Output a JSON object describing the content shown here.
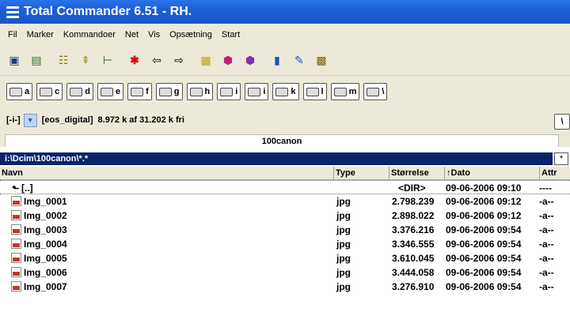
{
  "window": {
    "title": "Total Commander 6.51 - RH."
  },
  "menu": [
    "Fil",
    "Marker",
    "Kommandoer",
    "Net",
    "Vis",
    "Opsætning",
    "Start"
  ],
  "toolbar": {
    "icons": [
      "refresh-icon",
      "view-brief-icon",
      "view-full-icon",
      "tree-icon",
      "inverse-icon",
      "select-icon",
      "back-icon",
      "forward-icon",
      "pack-icon",
      "ftp-icon",
      "ftp-new-icon",
      "notepad-icon",
      "edit-icon",
      "explorer-icon"
    ]
  },
  "drives": [
    "a",
    "c",
    "d",
    "e",
    "f",
    "g",
    "h",
    "i",
    "i",
    "k",
    "l",
    "m",
    "\\"
  ],
  "pathbar": {
    "drive": "[-i-]",
    "label": "[eos_digital]",
    "free": "8.972 k af 31.202 k fri",
    "root_btn": "\\"
  },
  "panel": {
    "tab": "100canon",
    "path": "i:\\Dcim\\100canon\\*.*",
    "hist_btn": "*"
  },
  "columns": {
    "name": "Navn",
    "type": "Type",
    "size": "Størrelse",
    "date": "↑Dato",
    "attr": "Attr"
  },
  "updir": {
    "name": "[..]",
    "size": "<DIR>",
    "date": "09-06-2006 09:10",
    "attr": "----"
  },
  "files": [
    {
      "name": "Img_0001",
      "type": "jpg",
      "size": "2.798.239",
      "date": "09-06-2006 09:12",
      "attr": "-a--"
    },
    {
      "name": "Img_0002",
      "type": "jpg",
      "size": "2.898.022",
      "date": "09-06-2006 09:12",
      "attr": "-a--"
    },
    {
      "name": "Img_0003",
      "type": "jpg",
      "size": "3.376.216",
      "date": "09-06-2006 09:54",
      "attr": "-a--"
    },
    {
      "name": "Img_0004",
      "type": "jpg",
      "size": "3.346.555",
      "date": "09-06-2006 09:54",
      "attr": "-a--"
    },
    {
      "name": "Img_0005",
      "type": "jpg",
      "size": "3.610.045",
      "date": "09-06-2006 09:54",
      "attr": "-a--"
    },
    {
      "name": "Img_0006",
      "type": "jpg",
      "size": "3.444.058",
      "date": "09-06-2006 09:54",
      "attr": "-a--"
    },
    {
      "name": "Img_0007",
      "type": "jpg",
      "size": "3.276.910",
      "date": "09-06-2006 09:54",
      "attr": "-a--"
    }
  ],
  "colors": {
    "title_bar": "#1d5fd6",
    "selection": "#0a246a",
    "chrome": "#ece9d8"
  }
}
